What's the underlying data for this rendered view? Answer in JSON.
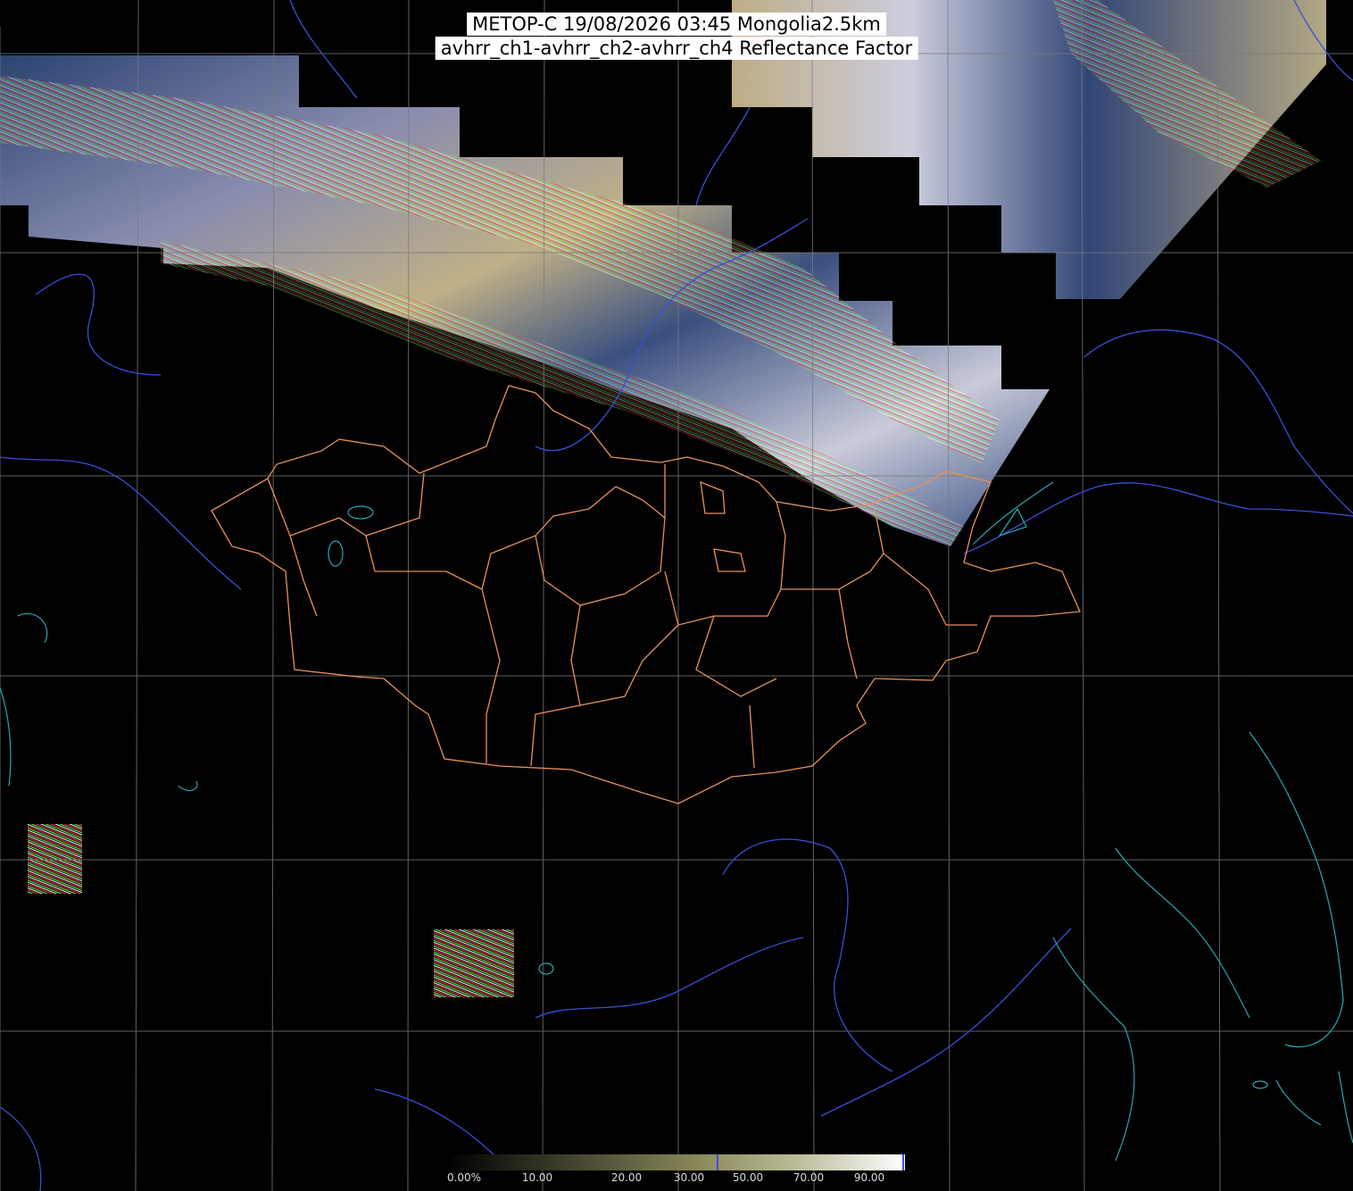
{
  "title": {
    "line1": "METOP-C 19/08/2026 03:45 Mongolia2.5km",
    "line2": "avhrr_ch1-avhrr_ch2-avhrr_ch4 Reflectance Factor"
  },
  "colorbar": {
    "ticks": [
      "0.00%",
      "10.00",
      "20.00",
      "30.00",
      "50.00",
      "70.00",
      "90.00"
    ],
    "tick_colors": {
      "low": "#000000",
      "mid": "#8a8a5a",
      "high": "#ffffff",
      "marker": "#3a4fd8"
    }
  },
  "colors": {
    "graticule": "#7a7a7a",
    "admin_border": "#e8915a",
    "coastline": "#2aa7b0",
    "river": "#3a4fd8",
    "cloud_white": "#d9dcea",
    "cloud_tan": "#c8b48a",
    "ground_blue": "#33477a"
  },
  "layers": [
    "satellite-swath",
    "graticule",
    "coastlines",
    "rivers",
    "mongolia-admin-borders",
    "colorbar"
  ]
}
